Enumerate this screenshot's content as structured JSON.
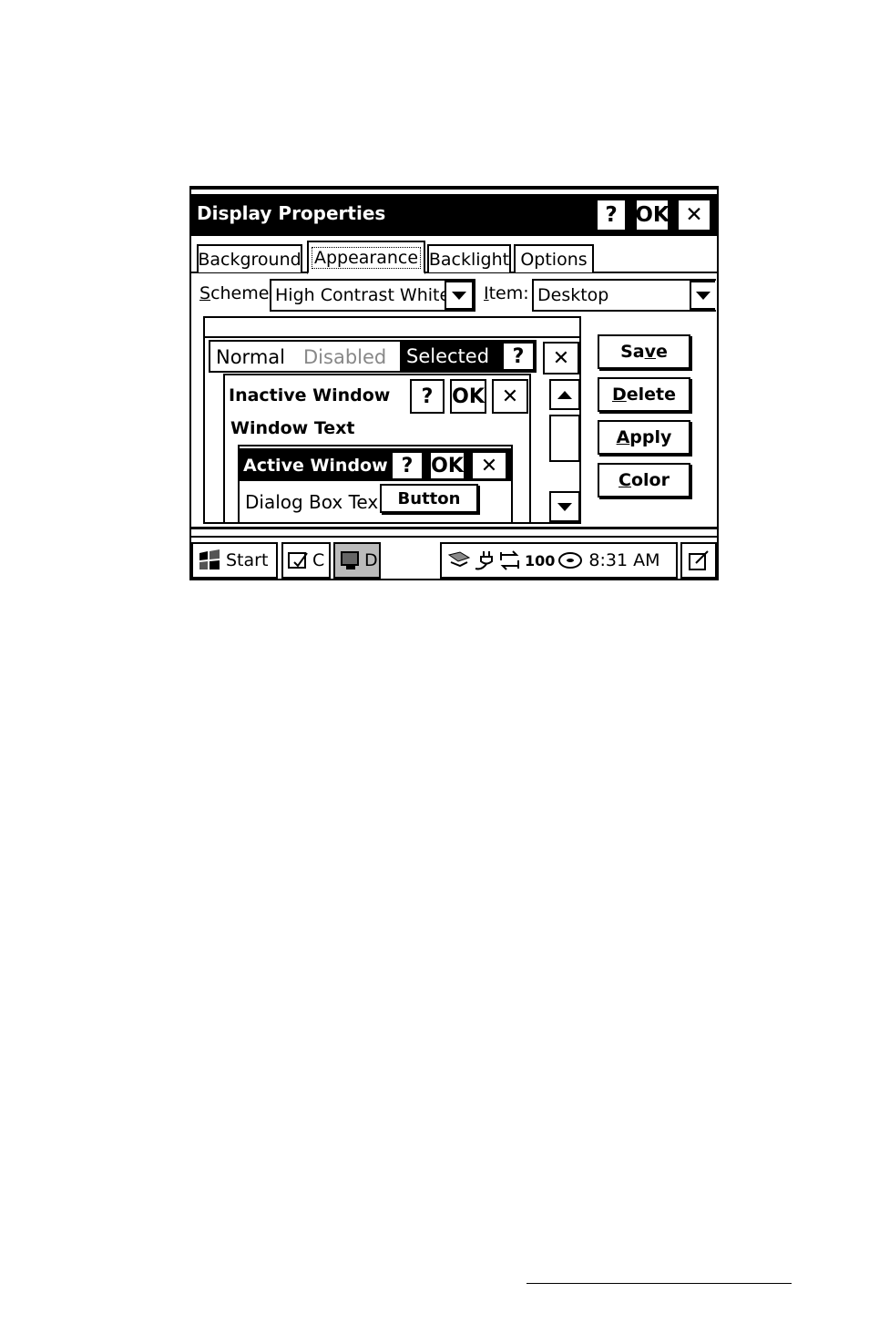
{
  "window": {
    "title": "Display Properties",
    "help_label": "?",
    "ok_label": "OK",
    "close_label": "✕"
  },
  "tabs": [
    {
      "label": "Background"
    },
    {
      "label": "Appearance"
    },
    {
      "label": "Backlight"
    },
    {
      "label": "Options"
    }
  ],
  "scheme": {
    "label_prefix": "S",
    "label_rest": "cheme:",
    "value": "High Contrast White"
  },
  "item": {
    "label_prefix": "I",
    "label_rest": "tem:",
    "value": "Desktop"
  },
  "preview": {
    "normal": "Normal",
    "disabled": "Disabled",
    "selected": "Selected",
    "help": "?",
    "close": "✕",
    "inactive_window": "Inactive Window",
    "window_text": "Window Text",
    "active_window": "Active Window",
    "ok": "OK",
    "dialog_text": "Dialog Box Tex",
    "button": "Button"
  },
  "buttons": {
    "save": {
      "pre": "Sa",
      "u": "v",
      "post": "e"
    },
    "delete": {
      "pre": "",
      "u": "D",
      "post": "elete"
    },
    "apply": {
      "pre": "",
      "u": "A",
      "post": "pply"
    },
    "color": {
      "pre": "",
      "u": "C",
      "post": "olor"
    }
  },
  "taskbar": {
    "start": "Start",
    "task1": "C",
    "task2": "D",
    "tray_battery": "100",
    "clock": "8:31 AM"
  },
  "icons": {
    "start": "windows-flag-icon",
    "task1": "control-panel-icon",
    "task2": "display-icon",
    "tray1": "network-icon",
    "tray2": "power-plug-icon",
    "tray3": "sync-icon",
    "tray4": "battery-icon",
    "tray5": "storage-icon",
    "desktop": "show-desktop-icon"
  }
}
